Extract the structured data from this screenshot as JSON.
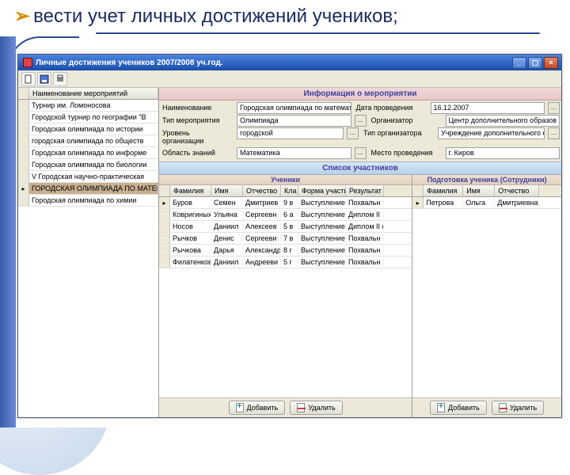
{
  "slide": {
    "title": "вести учет личных достижений учеников;"
  },
  "window": {
    "title": "Личные достижения учеников 2007/2008 уч.год.",
    "btn_min": "_",
    "btn_max": "▢",
    "btn_close": "×"
  },
  "left": {
    "header": "Наименование мероприятий",
    "rows": [
      "Турнир им. Ломоносова",
      "Городской турнир по географии \"В",
      "Городская олимпиада по истории",
      "городская олимпиада по обществ",
      "Городская олимпиада по информе",
      "Городская олимпиада по биологии",
      "V Городская научно-практическая",
      "ГОРОДСКАЯ ОЛИМПИАДА ПО МАТЕМА",
      "Городская олимпиада по химии"
    ],
    "selected_index": 7
  },
  "info": {
    "header": "Информация о мероприятии",
    "fields": [
      [
        {
          "label": "Наименование",
          "value": "Городская олимпиада по математике",
          "btn": false
        },
        {
          "label": "Дата проведения",
          "value": "16.12.2007",
          "btn": true
        }
      ],
      [
        {
          "label": "Тип мероприятия",
          "value": "Олимпиада",
          "btn": true
        },
        {
          "label": "Организатор",
          "value": "Центр дополнительного образов",
          "btn": false
        }
      ],
      [
        {
          "label": "Уровень организации",
          "value": "городской",
          "btn": true
        },
        {
          "label": "Тип организатора",
          "value": "Учреждение дополнительного обр",
          "btn": true
        }
      ],
      [
        {
          "label": "Область знаний",
          "value": "Математика",
          "btn": true
        },
        {
          "label": "Место проведения",
          "value": "г. Киров",
          "btn": false
        }
      ]
    ]
  },
  "participants": {
    "split_header": "Список участников",
    "left_header": "Ученики",
    "right_header": "Подготовка ученика (Сотрудники)",
    "cols_a": [
      "Фамилия",
      "Имя",
      "Отчество",
      "Кла",
      "Форма участия",
      "Результат"
    ],
    "cols_b": [
      "Фамилия",
      "Имя",
      "Отчество"
    ],
    "rows_a": [
      [
        "Буров",
        "Семен",
        "Дмитриев",
        "9 в",
        "Выступление",
        "Похвальн"
      ],
      [
        "Ковригиных",
        "Ульяна",
        "Сергеевн",
        "6 а",
        "Выступление",
        "Диплом II"
      ],
      [
        "Носов",
        "Даниил",
        "Алексеев",
        "5 в",
        "Выступление",
        "Диплом II с"
      ],
      [
        "Рычков",
        "Денис",
        "Сергееви",
        "7 в",
        "Выступление",
        "Похвальн"
      ],
      [
        "Рычкова",
        "Дарья",
        "Александр",
        "8 г",
        "Выступление",
        "Похвальн"
      ],
      [
        "Филатенков",
        "Даниил",
        "Андрееви",
        "5 г",
        "Выступление",
        "Похвальн"
      ]
    ],
    "rows_b": [
      [
        "Петрова",
        "Ольга",
        "Дмитриевна"
      ]
    ],
    "btn_add": "Добавить",
    "btn_del": "Удалить"
  }
}
